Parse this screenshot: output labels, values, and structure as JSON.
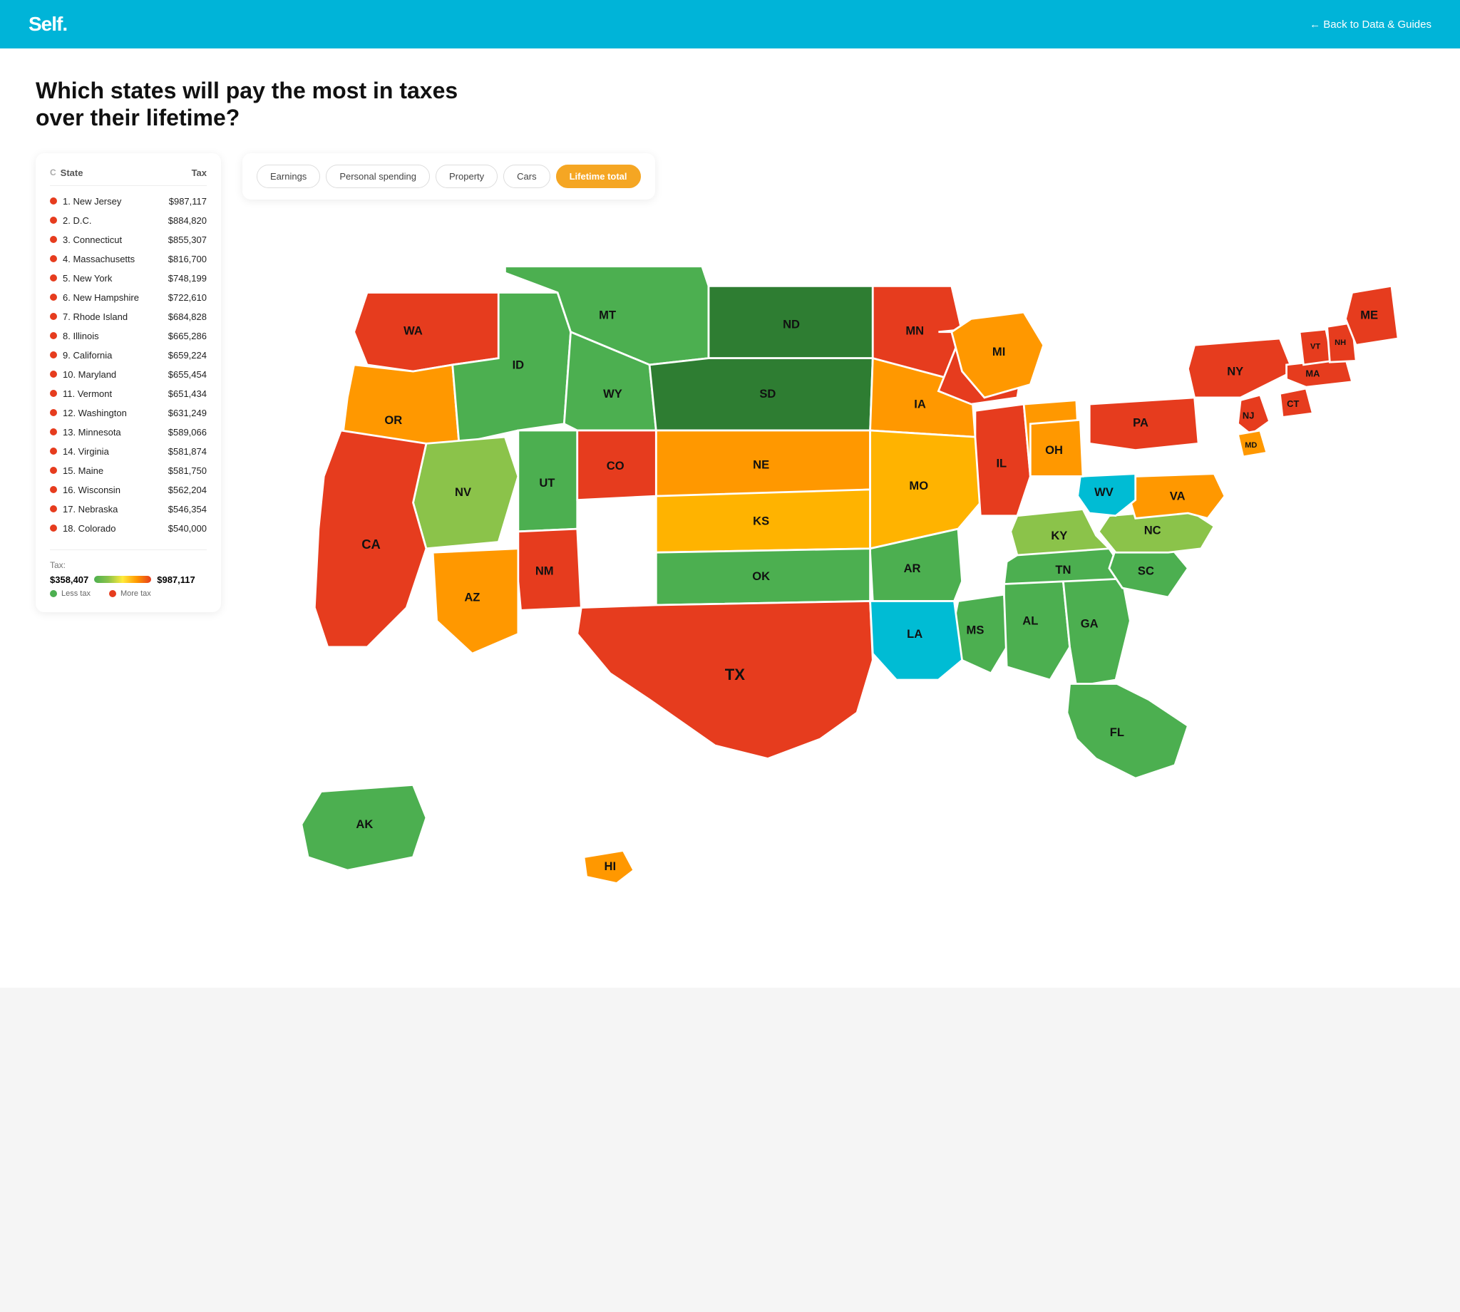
{
  "header": {
    "logo": "Self.",
    "back_link": "← Back to Data & Guides"
  },
  "page": {
    "title": "Which states will pay the most in taxes over their lifetime?"
  },
  "tabs": [
    {
      "label": "Earnings",
      "active": false
    },
    {
      "label": "Personal spending",
      "active": false
    },
    {
      "label": "Property",
      "active": false
    },
    {
      "label": "Cars",
      "active": false
    },
    {
      "label": "Lifetime total",
      "active": true
    }
  ],
  "table": {
    "col_c": "C",
    "col_state": "State",
    "col_tax": "Tax",
    "rows": [
      {
        "rank": "1",
        "state": "New Jersey",
        "tax": "$987,117"
      },
      {
        "rank": "2",
        "state": "D.C.",
        "tax": "$884,820"
      },
      {
        "rank": "3",
        "state": "Connecticut",
        "tax": "$855,307"
      },
      {
        "rank": "4",
        "state": "Massachusetts",
        "tax": "$816,700"
      },
      {
        "rank": "5",
        "state": "New York",
        "tax": "$748,199"
      },
      {
        "rank": "6",
        "state": "New Hampshire",
        "tax": "$722,610"
      },
      {
        "rank": "7",
        "state": "Rhode Island",
        "tax": "$684,828"
      },
      {
        "rank": "8",
        "state": "Illinois",
        "tax": "$665,286"
      },
      {
        "rank": "9",
        "state": "California",
        "tax": "$659,224"
      },
      {
        "rank": "10",
        "state": "Maryland",
        "tax": "$655,454"
      },
      {
        "rank": "11",
        "state": "Vermont",
        "tax": "$651,434"
      },
      {
        "rank": "12",
        "state": "Washington",
        "tax": "$631,249"
      },
      {
        "rank": "13",
        "state": "Minnesota",
        "tax": "$589,066"
      },
      {
        "rank": "14",
        "state": "Virginia",
        "tax": "$581,874"
      },
      {
        "rank": "15",
        "state": "Maine",
        "tax": "$581,750"
      },
      {
        "rank": "16",
        "state": "Wisconsin",
        "tax": "$562,204"
      },
      {
        "rank": "17",
        "state": "Nebraska",
        "tax": "$546,354"
      },
      {
        "rank": "18",
        "state": "Colorado",
        "tax": "$540,000"
      }
    ]
  },
  "legend": {
    "label": "Tax:",
    "min": "$358,407",
    "max": "$987,117",
    "less_tax": "Less tax",
    "more_tax": "More tax"
  }
}
